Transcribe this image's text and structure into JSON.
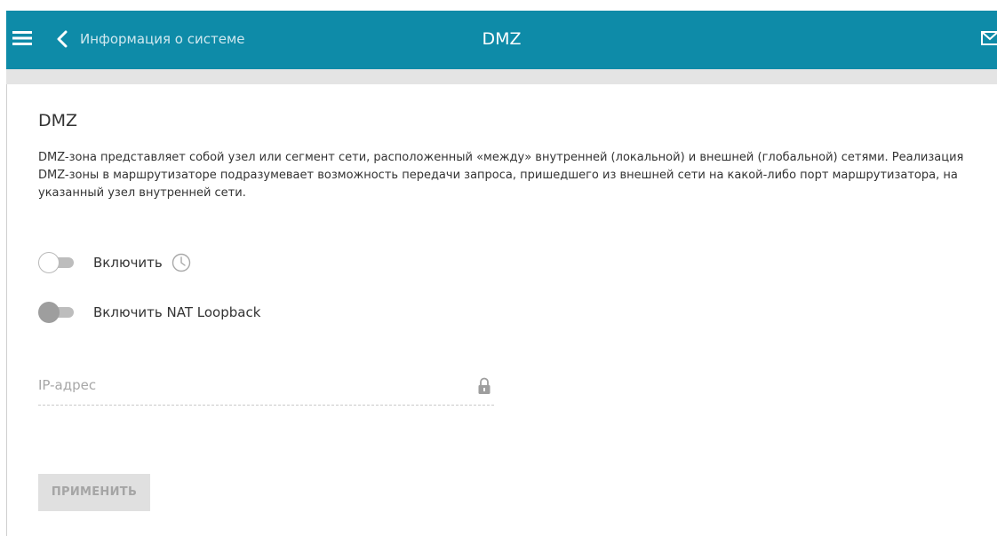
{
  "header": {
    "back_label": "Информация о системе",
    "title": "DMZ",
    "menu_icon": "hamburger-menu-icon",
    "back_icon": "chevron-left-icon",
    "message_icon": "envelope-icon",
    "background_color": "#0e8ba8"
  },
  "main": {
    "section_title": "DMZ",
    "description": "DMZ-зона представляет собой узел или сегмент сети, расположенный «между» внутренней (локальной) и внешней (глобальной) сетями. Реализация DMZ-зоны в маршрутизаторе подразумевает возможность передачи запроса, пришедшего из внешней сети на какой-либо порт маршрутизатора, на указанный узел внутренней сети.",
    "toggles": [
      {
        "label": "Включить",
        "state": "off",
        "has_schedule_icon": true,
        "schedule_icon": "clock-icon"
      },
      {
        "label": "Включить NAT Loopback",
        "state": "off-disabled"
      }
    ],
    "ip_field": {
      "placeholder": "IP-адрес",
      "value": "",
      "locked": true,
      "lock_icon": "lock-icon"
    },
    "apply_button": {
      "label": "ПРИМЕНИТЬ",
      "enabled": false
    }
  }
}
